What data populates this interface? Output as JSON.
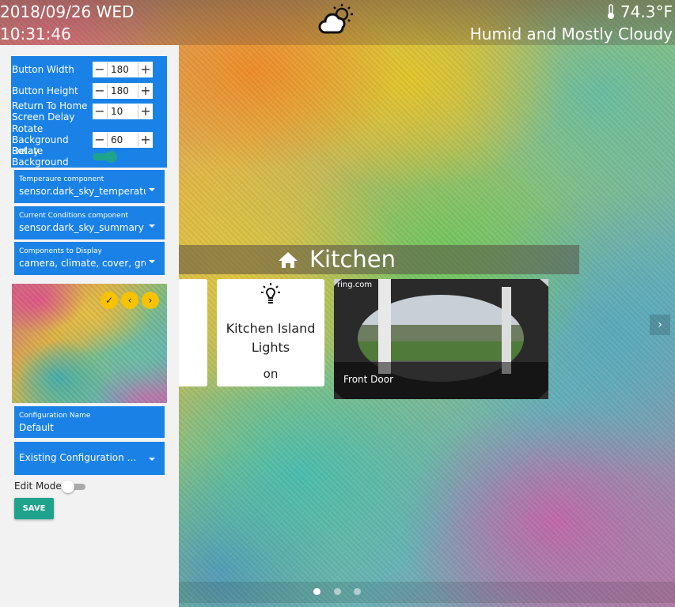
{
  "header": {
    "date": "2018/09/26 WED",
    "time": "10:31:46",
    "weather_icon": "partly-cloudy-icon",
    "temperature": "74.3°F",
    "conditions": "Humid and Mostly Cloudy"
  },
  "settings": {
    "button_width": {
      "label": "Button Width",
      "value": "180"
    },
    "button_height": {
      "label": "Button Height",
      "value": "180"
    },
    "return_home_delay": {
      "label": "Return To Home Screen Delay",
      "value": "10"
    },
    "rotate_bg_delay": {
      "label": "Rotate Background Delay",
      "value": "60"
    },
    "rotate_bg": {
      "label": "Rotate Background",
      "checked": true
    }
  },
  "selects": {
    "temperature_component": {
      "label": "Temperaure component",
      "value": "sensor.dark_sky_temperature"
    },
    "conditions_component": {
      "label": "Current Conditions component",
      "value": "sensor.dark_sky_summary"
    },
    "components_display": {
      "label": "Components to Display",
      "value": "camera, climate, cover, group, l"
    }
  },
  "preview": {
    "buttons": [
      "✓",
      "‹",
      "›"
    ]
  },
  "config": {
    "name_label": "Configuration Name",
    "name_value": "Default",
    "existing_label": "Existing Configuration Names"
  },
  "edit_mode": {
    "label": "Edit Mode",
    "checked": false
  },
  "save_label": "SAVE",
  "room": {
    "title": "Kitchen"
  },
  "tiles": {
    "kitchen_lights": {
      "name": "Kitchen Island Lights",
      "state": "on"
    },
    "camera": {
      "brand": "ring.com",
      "name": "Front Door"
    }
  },
  "pager": {
    "count": 3,
    "active": 0
  },
  "colors": {
    "accent": "#1a82e6",
    "teal": "#1fa38c",
    "yellow": "#f7c300"
  }
}
